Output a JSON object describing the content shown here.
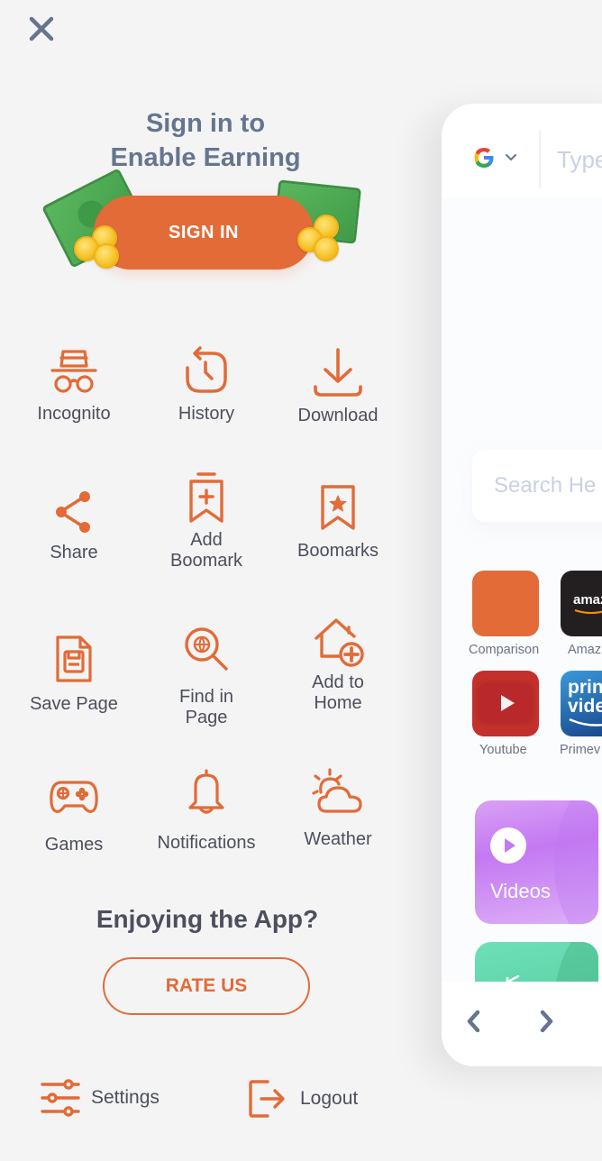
{
  "colors": {
    "accent": "#e26b37",
    "title_slate": "#66758f",
    "text_dark": "#4c4f5c",
    "background": "#f4f4f5"
  },
  "header": {
    "close_icon": "close-icon"
  },
  "signin": {
    "title_line1": "Sign in to",
    "title_line2": "Enable Earning",
    "button_label": "SIGN IN"
  },
  "menu": {
    "items": [
      {
        "label": "Incognito",
        "icon": "incognito-icon"
      },
      {
        "label": "History",
        "icon": "history-icon"
      },
      {
        "label": "Download",
        "icon": "download-icon"
      },
      {
        "label": "Share",
        "icon": "share-icon"
      },
      {
        "label_line1": "Add",
        "label_line2": "Boomark",
        "icon": "add-bookmark-icon"
      },
      {
        "label": "Boomarks",
        "icon": "bookmarks-icon"
      },
      {
        "label": "Save Page",
        "icon": "save-page-icon"
      },
      {
        "label_line1": "Find in",
        "label_line2": "Page",
        "icon": "find-in-page-icon"
      },
      {
        "label_line1": "Add to",
        "label_line2": "Home",
        "icon": "add-to-home-icon"
      },
      {
        "label": "Games",
        "icon": "gamepad-icon"
      },
      {
        "label": "Notifications",
        "icon": "bell-icon"
      },
      {
        "label": "Weather",
        "icon": "weather-icon"
      }
    ]
  },
  "rating": {
    "title": "Enjoying the App?",
    "button_label": "RATE US"
  },
  "footer": {
    "settings_label": "Settings",
    "logout_label": "Logout"
  },
  "preview": {
    "search_engine": "G",
    "address_placeholder": "Type",
    "search_placeholder": "Search He",
    "shortcuts": [
      {
        "label": "Comparison",
        "color": "#e26b37"
      },
      {
        "label": "Amaz",
        "logo_text": "amaz",
        "color": "#231f20"
      },
      {
        "label": "Youtube",
        "color": "#c4302b"
      },
      {
        "label": "Primev",
        "logo_line1": "prin",
        "logo_line2": "vide",
        "color": "#1a5ea8"
      }
    ],
    "cards": [
      {
        "label": "Videos",
        "color": "#c27ef0"
      },
      {
        "label": "",
        "color": "#5fcf9f"
      }
    ]
  }
}
